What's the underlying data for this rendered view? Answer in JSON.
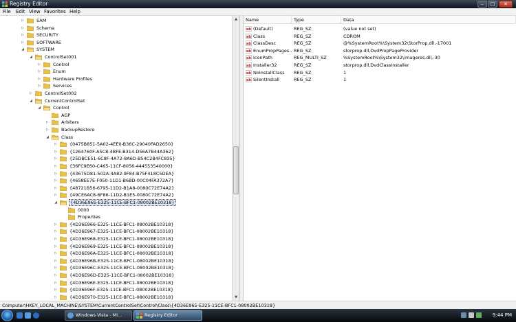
{
  "window": {
    "title": "Registry Editor"
  },
  "menu": [
    "File",
    "Edit",
    "View",
    "Favorites",
    "Help"
  ],
  "tree": [
    {
      "label": "SAM",
      "depth": 1,
      "open": false
    },
    {
      "label": "Schema",
      "depth": 1,
      "open": false
    },
    {
      "label": "SECURITY",
      "depth": 1,
      "open": false
    },
    {
      "label": "SOFTWARE",
      "depth": 1,
      "open": false
    },
    {
      "label": "SYSTEM",
      "depth": 1,
      "open": true
    },
    {
      "label": "ControlSet001",
      "depth": 2,
      "open": true
    },
    {
      "label": "Control",
      "depth": 3,
      "open": false
    },
    {
      "label": "Enum",
      "depth": 3,
      "open": false
    },
    {
      "label": "Hardware Profiles",
      "depth": 3,
      "open": false
    },
    {
      "label": "Services",
      "depth": 3,
      "open": false
    },
    {
      "label": "ControlSet002",
      "depth": 2,
      "open": false
    },
    {
      "label": "CurrentControlSet",
      "depth": 2,
      "open": true
    },
    {
      "label": "Control",
      "depth": 3,
      "open": true
    },
    {
      "label": "AGP",
      "depth": 4,
      "open": false,
      "leaf": true
    },
    {
      "label": "Arbiters",
      "depth": 4,
      "open": false
    },
    {
      "label": "BackupRestore",
      "depth": 4,
      "open": false
    },
    {
      "label": "Class",
      "depth": 4,
      "open": true
    },
    {
      "label": "{0475B851-5A02-4EE0-B36C-29040FAD2650}",
      "depth": 5,
      "open": false
    },
    {
      "label": "{1264760F-A5C8-4BFE-B314-D56A7B44A362}",
      "depth": 5,
      "open": false
    },
    {
      "label": "{25DBCE51-6C8F-4A72-8A6D-B54C2B4FC835}",
      "depth": 5,
      "open": false
    },
    {
      "label": "{36FC9E60-C465-11CF-8056-444553540000}",
      "depth": 5,
      "open": false
    },
    {
      "label": "{43675D81-502A-4A82-9F84-B75F418C5DEA}",
      "depth": 5,
      "open": false
    },
    {
      "label": "{4658EE7E-F050-11D1-B6BD-00C04FA372A7}",
      "depth": 5,
      "open": false
    },
    {
      "label": "{48721B56-6795-11D2-B1A8-0080C72E74A2}",
      "depth": 5,
      "open": false
    },
    {
      "label": "{49CE6AC8-6F86-11D2-B1E5-0080C72E74A2}",
      "depth": 5,
      "open": false
    },
    {
      "label": "{4D36E965-E325-11CE-BFC1-08002BE10318}",
      "depth": 5,
      "open": true,
      "selected": true
    },
    {
      "label": "0000",
      "depth": 6,
      "open": false,
      "leaf": true
    },
    {
      "label": "Properties",
      "depth": 6,
      "open": false,
      "leaf": true
    },
    {
      "label": "{4D36E966-E325-11CE-BFC1-08002BE10318}",
      "depth": 5,
      "open": false
    },
    {
      "label": "{4D36E967-E325-11CE-BFC1-08002BE10318}",
      "depth": 5,
      "open": false
    },
    {
      "label": "{4D36E968-E325-11CE-BFC1-08002BE10318}",
      "depth": 5,
      "open": false
    },
    {
      "label": "{4D36E969-E325-11CE-BFC1-08002BE10318}",
      "depth": 5,
      "open": false
    },
    {
      "label": "{4D36E96A-E325-11CE-BFC1-08002BE10318}",
      "depth": 5,
      "open": false
    },
    {
      "label": "{4D36E96B-E325-11CE-BFC1-08002BE10318}",
      "depth": 5,
      "open": false
    },
    {
      "label": "{4D36E96C-E325-11CE-BFC1-08002BE10318}",
      "depth": 5,
      "open": false
    },
    {
      "label": "{4D36E96D-E325-11CE-BFC1-08002BE10318}",
      "depth": 5,
      "open": false
    },
    {
      "label": "{4D36E96E-E325-11CE-BFC1-08002BE10318}",
      "depth": 5,
      "open": false
    },
    {
      "label": "{4D36E96F-E325-11CE-BFC1-08002BE10318}",
      "depth": 5,
      "open": false
    },
    {
      "label": "{4D36E970-E325-11CE-BFC1-08002BE10318}",
      "depth": 5,
      "open": false
    }
  ],
  "list": {
    "columns": [
      "Name",
      "Type",
      "Data"
    ],
    "rows": [
      {
        "name": "(Default)",
        "type": "REG_SZ",
        "data": "(value not set)"
      },
      {
        "name": "Class",
        "type": "REG_SZ",
        "data": "CDROM"
      },
      {
        "name": "ClassDesc",
        "type": "REG_SZ",
        "data": "@%SystemRoot%\\System32\\StorProp.dll,-17001"
      },
      {
        "name": "EnumPropPages...",
        "type": "REG_SZ",
        "data": "storprop.dll,DvdPropPageProvider"
      },
      {
        "name": "IconPath",
        "type": "REG_MULTI_SZ",
        "data": "%SystemRoot%\\System32\\imageres.dll,-30"
      },
      {
        "name": "Installer32",
        "type": "REG_SZ",
        "data": "storprop.dll,DvdClassInstaller"
      },
      {
        "name": "NoInstallClass",
        "type": "REG_SZ",
        "data": "1"
      },
      {
        "name": "SilentInstall",
        "type": "REG_SZ",
        "data": "1"
      }
    ]
  },
  "status": "Computer\\HKEY_LOCAL_MACHINE\\SYSTEM\\CurrentControlSet\\Control\\Class\\{4D36E965-E325-11CE-BFC1-08002BE10318}",
  "taskbar": {
    "buttons": [
      {
        "label": "Windows Vista - Mi...",
        "icon": "browser-icon",
        "active": false
      },
      {
        "label": "Registry Editor",
        "icon": "regedit-icon",
        "active": true
      }
    ],
    "clock": "9:44 PM"
  },
  "colors": {
    "folder": "#e8c04a",
    "selection": "#dfe9f7",
    "taskbar": "#0b1422"
  }
}
